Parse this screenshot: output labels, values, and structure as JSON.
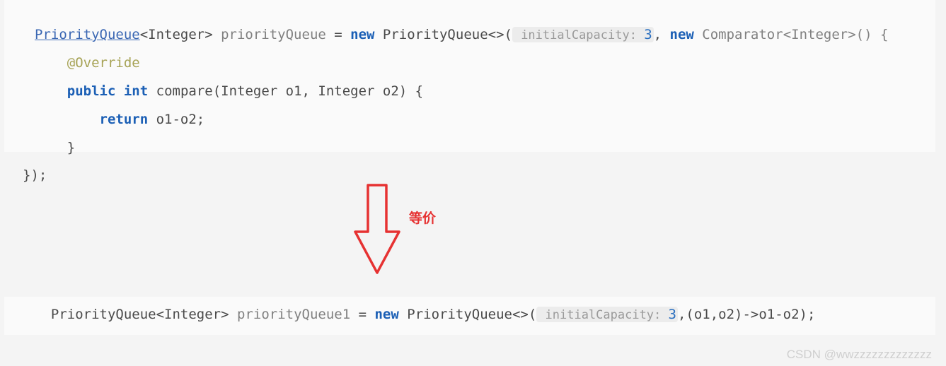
{
  "code1": {
    "l1": {
      "type_link": "PriorityQueue",
      "generic1": "<Integer>",
      "var": " priorityQueue",
      "eq": " = ",
      "new": "new",
      "ctor": " PriorityQueue<>(",
      "hint": " initialCapacity: ",
      "val": "3",
      "comma": ", ",
      "new2": "new",
      "comp": " Comparator<Integer>() {"
    },
    "l2": {
      "indent": "    ",
      "anno": "@Override"
    },
    "l3": {
      "indent": "    ",
      "public": "public",
      "sp": " ",
      "int": "int",
      "sig": " compare(Integer o1, Integer o2) {"
    },
    "l4": {
      "indent": "        ",
      "ret": "return",
      "expr": " o1-o2;"
    },
    "l5": {
      "indent": "    ",
      "close": "}"
    },
    "l6": {
      "close": "});"
    }
  },
  "arrow": {
    "label": "等价"
  },
  "code2": {
    "l1": {
      "indent": "  ",
      "type": "PriorityQueue<Integer>",
      "var": " priorityQueue1",
      "eq": " = ",
      "new": "new",
      "ctor": " PriorityQueue<>(",
      "hint": " initialCapacity: ",
      "val": "3",
      "rest": ",(o1,o2)->o1-o2);"
    }
  },
  "watermark": "CSDN @wwzzzzzzzzzzzzz"
}
